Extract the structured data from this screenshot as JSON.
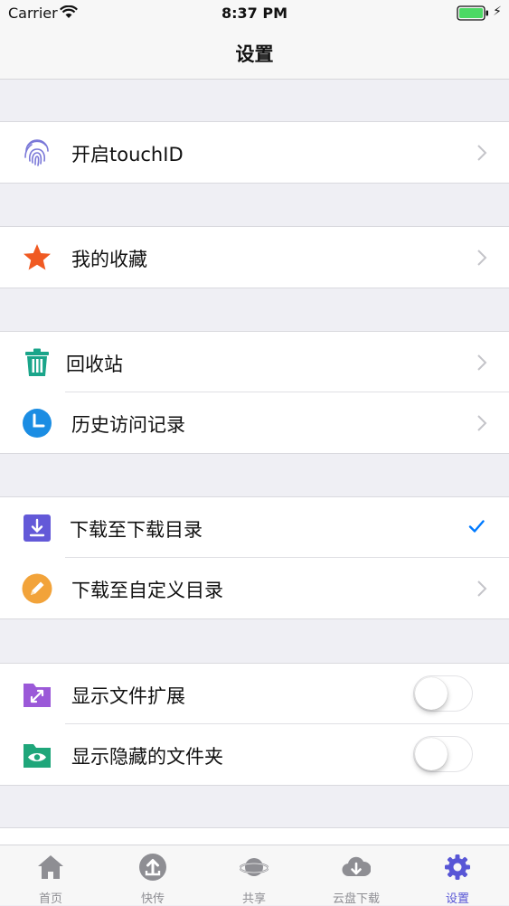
{
  "status": {
    "carrier": "Carrier",
    "time": "8:37 PM"
  },
  "nav": {
    "title": "设置"
  },
  "groups": {
    "touchid": {
      "label": "开启touchID"
    },
    "favorites": {
      "label": "我的收藏"
    },
    "recycle": {
      "label": "回收站"
    },
    "history": {
      "label": "历史访问记录"
    },
    "download_default": {
      "label": "下载至下载目录",
      "selected": true
    },
    "download_custom": {
      "label": "下载至自定义目录"
    },
    "show_ext": {
      "label": "显示文件扩展",
      "on": false
    },
    "show_hidden": {
      "label": "显示隐藏的文件夹",
      "on": false
    }
  },
  "tabs": [
    {
      "label": "首页",
      "icon": "home-icon"
    },
    {
      "label": "快传",
      "icon": "upload-icon"
    },
    {
      "label": "共享",
      "icon": "planet-icon"
    },
    {
      "label": "云盘下载",
      "icon": "cloud-download-icon"
    },
    {
      "label": "设置",
      "icon": "gear-icon",
      "active": true
    }
  ],
  "colors": {
    "accent": "#5856d6",
    "check": "#007aff",
    "star": "#f05a22",
    "recycle": "#1aa58a",
    "history": "#1b8de3",
    "download": "#6359d8",
    "edit": "#f2a33a",
    "ext": "#9b59d8",
    "hidden": "#1fa67a"
  }
}
